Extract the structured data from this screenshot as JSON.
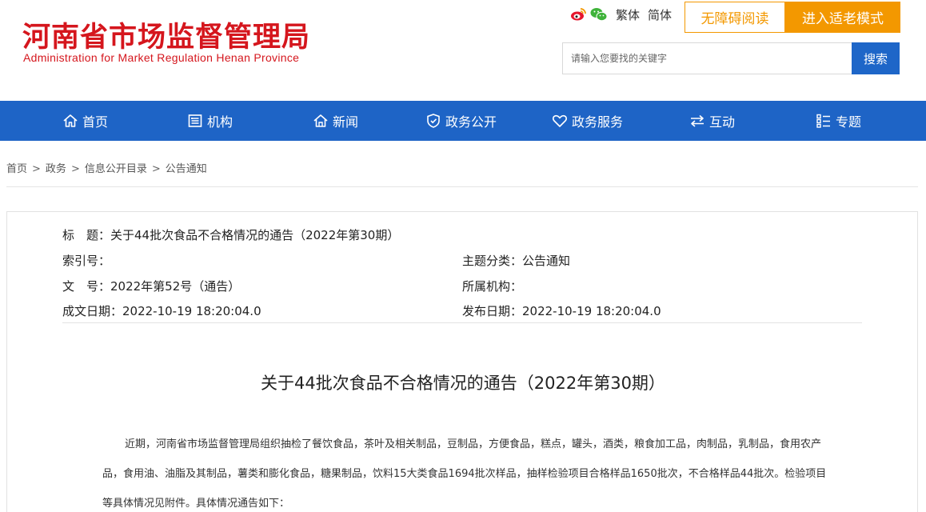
{
  "header": {
    "logo_cn": "河南省市场监督管理局",
    "logo_en": "Administration for Market Regulation Henan Province",
    "lang_traditional": "繁体",
    "lang_simplified": "简体",
    "accessibility_label": "无障碍阅读",
    "elder_mode_label": "进入适老模式",
    "search_placeholder": "请输入您要找的关键字",
    "search_button": "搜索",
    "icons": [
      "weibo-icon",
      "wechat-icon"
    ]
  },
  "nav": {
    "items": [
      {
        "label": "首页",
        "icon": "home-icon"
      },
      {
        "label": "机构",
        "icon": "org-icon"
      },
      {
        "label": "新闻",
        "icon": "news-icon"
      },
      {
        "label": "政务公开",
        "icon": "gov-open-icon"
      },
      {
        "label": "政务服务",
        "icon": "service-icon"
      },
      {
        "label": "互动",
        "icon": "interaction-icon"
      },
      {
        "label": "专题",
        "icon": "topic-icon"
      }
    ]
  },
  "breadcrumb": {
    "items": [
      "首页",
      "政务",
      "信息公开目录",
      "公告通知"
    ],
    "separator": ">"
  },
  "meta": {
    "title_line": "标　题：关于44批次食品不合格情况的通告（2022年第30期）",
    "index_no": "索引号：",
    "topic": "主题分类：公告通知",
    "doc_no": "文　号：2022年第52号（通告）",
    "agency": "所属机构：",
    "created": "成文日期：2022-10-19 18:20:04.0",
    "published": "发布日期：2022-10-19 18:20:04.0"
  },
  "article": {
    "title": "关于44批次食品不合格情况的通告（2022年第30期）",
    "body": "近期，河南省市场监督管理局组织抽检了餐饮食品，茶叶及相关制品，豆制品，方便食品，糕点，罐头，酒类，粮食加工品，肉制品，乳制品，食用农产品，食用油、油脂及其制品，薯类和膨化食品，糖果制品，饮料15大类食品1694批次样品，抽样检验项目合格样品1650批次，不合格样品44批次。检验项目等具体情况见附件。具体情况通告如下："
  },
  "colors": {
    "brand_red": "#d5161d",
    "nav_blue": "#1e64c6",
    "accent_orange": "#f39800"
  }
}
